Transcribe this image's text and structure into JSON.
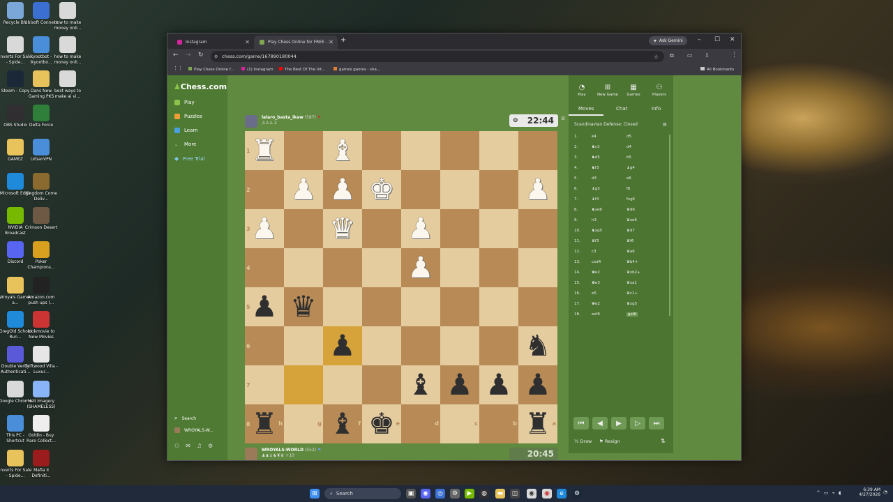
{
  "desktop": {
    "icons": [
      {
        "label": "Recycle Bin",
        "icon": "recycle-bin-icon",
        "color": "#7aa6d8"
      },
      {
        "label": "Ubisoft Connect",
        "icon": "ubisoft-icon",
        "color": "#3b6fd1"
      },
      {
        "label": "how to make money onli...",
        "icon": "chrome-shortcut-icon",
        "color": "#d9d9d9"
      },
      {
        "label": "Inverts For Sale - Spide...",
        "icon": "chrome-shortcut-icon",
        "color": "#d9d9d9"
      },
      {
        "label": "kyootbot - Ikyootbo...",
        "icon": "chrome-shortcut-icon",
        "color": "#4a8ed9"
      },
      {
        "label": "how to make money onli...",
        "icon": "chrome-shortcut-icon",
        "color": "#d9d9d9"
      },
      {
        "label": "Steam - Copy",
        "icon": "steam-icon",
        "color": "#1b2838"
      },
      {
        "label": "Dans New Gaming PKS",
        "icon": "folder-icon",
        "color": "#e8c25a"
      },
      {
        "label": "best ways to make ai vi...",
        "icon": "chrome-shortcut-icon",
        "color": "#d9d9d9"
      },
      {
        "label": "OBS Studio",
        "icon": "obs-icon",
        "color": "#302e31"
      },
      {
        "label": "Delta Force",
        "icon": "delta-force-icon",
        "color": "#2f7f3a"
      },
      {
        "label": "GAMEZ",
        "icon": "folder-icon",
        "color": "#e8c25a"
      },
      {
        "label": "UrbanVPN",
        "icon": "urbanvpn-icon",
        "color": "#4a8ed9"
      },
      {
        "label": "Microsoft Edge",
        "icon": "edge-icon",
        "color": "#1f8ad9"
      },
      {
        "label": "Kingdom Come Deliv...",
        "icon": "kingdom-come-icon",
        "color": "#8a6a2e"
      },
      {
        "label": "NVIDIA Broadcast",
        "icon": "nvidia-icon",
        "color": "#76b900"
      },
      {
        "label": "Crimson Desert",
        "icon": "crimson-desert-icon",
        "color": "#6e5a44"
      },
      {
        "label": "Discord",
        "icon": "discord-icon",
        "color": "#5865f2"
      },
      {
        "label": "Poker Champions...",
        "icon": "poker-icon",
        "color": "#d9a020"
      },
      {
        "label": "Wroyals Games a...",
        "icon": "folder-icon",
        "color": "#e8c25a"
      },
      {
        "label": "Amazon.com push ups (...",
        "icon": "amazon-icon",
        "color": "#222"
      },
      {
        "label": "GregOld School Run...",
        "icon": "edge-icon",
        "color": "#1f8ad9"
      },
      {
        "label": "lookmovie to New Movies",
        "icon": "lookmovie-icon",
        "color": "#c33"
      },
      {
        "label": "Double Verify Authenticati...",
        "icon": "shield-icon",
        "color": "#5a5ad9"
      },
      {
        "label": "Driftwood Villa - Luxur...",
        "icon": "document-icon",
        "color": "#e6e6e6"
      },
      {
        "label": "Google Chrome",
        "icon": "chrome-icon",
        "color": "#d9d9d9"
      },
      {
        "label": "Heli Imagery (SHAMELESS)",
        "icon": "heart-icon",
        "color": "#8ab4f8"
      },
      {
        "label": "This PC - Shortcut",
        "icon": "pc-icon",
        "color": "#4a8ed9"
      },
      {
        "label": "Goldin - Buy Rare Collect...",
        "icon": "goldin-icon",
        "color": "#eeeeee"
      },
      {
        "label": "Inverts For Sale - Spide...",
        "icon": "folder-icon",
        "color": "#e8c25a"
      },
      {
        "label": "Mafia II Definiti...",
        "icon": "mafia-icon",
        "color": "#9a1c1c"
      }
    ]
  },
  "browser": {
    "tabs": [
      {
        "label": "Instagram",
        "active": false,
        "icon": "instagram-icon"
      },
      {
        "label": "Play Chess Online for FREE - 2",
        "active": true,
        "icon": "chess-favicon-icon"
      }
    ],
    "new_tab": "+",
    "ask_gemini": "Ask Gemini",
    "url": "chess.com/game/167890180044",
    "bookmarks": [
      {
        "label": "Play Chess Online f...",
        "icon": "chess-favicon-icon",
        "color": "#7fa650"
      },
      {
        "label": "(1) Instagram",
        "icon": "instagram-icon",
        "color": "#d6249f"
      },
      {
        "label": "The Best Of The Int...",
        "icon": "youtube-icon",
        "color": "#ff0000"
      },
      {
        "label": "games games - sha...",
        "icon": "game-icon",
        "color": "#e08030"
      }
    ],
    "all_bookmarks": "All Bookmarks"
  },
  "chess_site": {
    "logo": "Chess.com",
    "nav": [
      {
        "label": "Play",
        "color": "#8bc34a"
      },
      {
        "label": "Puzzles",
        "color": "#f0a030"
      },
      {
        "label": "Learn",
        "color": "#4aa0e0"
      },
      {
        "label": "More",
        "color": "#cfcfcf"
      },
      {
        "label": "Free Trial",
        "color": "#7bc6e8"
      }
    ],
    "search_label": "Search",
    "username_short": "WROYALS-W..."
  },
  "game": {
    "opponent": {
      "name": "lalaro_basta_ikaw",
      "rating": "(587)",
      "captured": "♙♙♙ 2"
    },
    "player": {
      "name": "WROYALS-WORLD",
      "rating": "(552)",
      "captured": "♟♟♝♞♜♛ +10"
    },
    "opponent_clock": "22:44",
    "player_clock": "20:45",
    "ranks": [
      "1",
      "2",
      "3",
      "4",
      "5",
      "6",
      "7",
      "8"
    ],
    "files": [
      "h",
      "g",
      "f",
      "e",
      "d",
      "c",
      "b",
      "a"
    ],
    "board": [
      [
        "wR",
        "",
        "wB",
        "",
        "",
        "",
        "",
        ""
      ],
      [
        "",
        "wP",
        "wP",
        "wK",
        "",
        "",
        "",
        "wP"
      ],
      [
        "wP",
        "",
        "wQ",
        "",
        "wP",
        "",
        "",
        ""
      ],
      [
        "",
        "",
        "",
        "",
        "wP",
        "",
        "",
        ""
      ],
      [
        "bP",
        "bQ",
        "",
        "",
        "",
        "",
        "",
        ""
      ],
      [
        "",
        "",
        "bP",
        "",
        "",
        "",
        "",
        "bN"
      ],
      [
        "",
        "",
        "",
        "",
        "bB",
        "bP",
        "bP",
        "bP"
      ],
      [
        "bR",
        "",
        "bB",
        "bK",
        "",
        "",
        "",
        "bR"
      ]
    ],
    "highlights": [
      [
        5,
        2
      ],
      [
        6,
        1
      ]
    ]
  },
  "side_panel": {
    "top_buttons": [
      {
        "label": "Play",
        "icon": "play-clock-icon"
      },
      {
        "label": "New Game",
        "icon": "plus-icon"
      },
      {
        "label": "Games",
        "icon": "games-icon"
      },
      {
        "label": "Players",
        "icon": "players-icon"
      }
    ],
    "tabs": [
      "Moves",
      "Chat",
      "Info"
    ],
    "opening": "Scandinavian Defense: Closed",
    "moves": [
      {
        "n": "1.",
        "w": "e4",
        "b": "d5"
      },
      {
        "n": "2.",
        "w": "♞c3",
        "b": "d4"
      },
      {
        "n": "3.",
        "w": "♞d5",
        "b": "b5"
      },
      {
        "n": "4.",
        "w": "♞f3",
        "b": "♝g4"
      },
      {
        "n": "5.",
        "w": "d3",
        "b": "e6"
      },
      {
        "n": "6.",
        "w": "♝g5",
        "b": "f6"
      },
      {
        "n": "7.",
        "w": "♝f4",
        "b": "fxg5"
      },
      {
        "n": "8.",
        "w": "♞xe6",
        "b": "♛d6"
      },
      {
        "n": "9.",
        "w": "h3",
        "b": "♛xe6"
      },
      {
        "n": "10.",
        "w": "♞xg5",
        "b": "♛d7"
      },
      {
        "n": "11.",
        "w": "♛f3",
        "b": "♛f6"
      },
      {
        "n": "12.",
        "w": "c3",
        "b": "♛a6"
      },
      {
        "n": "13.",
        "w": "cxd4",
        "b": "♛b4+"
      },
      {
        "n": "14.",
        "w": "♚e2",
        "b": "♛xb2+"
      },
      {
        "n": "15.",
        "w": "♚e3",
        "b": "♛xa1"
      },
      {
        "n": "16.",
        "w": "e5",
        "b": "♛c1+"
      },
      {
        "n": "17.",
        "w": "♚e2",
        "b": "♛xg5"
      },
      {
        "n": "18.",
        "w": "exf6",
        "b": "gxf6"
      }
    ],
    "controls": [
      "⏮",
      "◀",
      "▶",
      "▷",
      "⏭"
    ],
    "draw": "Draw",
    "resign": "Resign"
  },
  "taskbar": {
    "search": "Search",
    "time": "6:39 AM",
    "date": "4/27/2026"
  }
}
